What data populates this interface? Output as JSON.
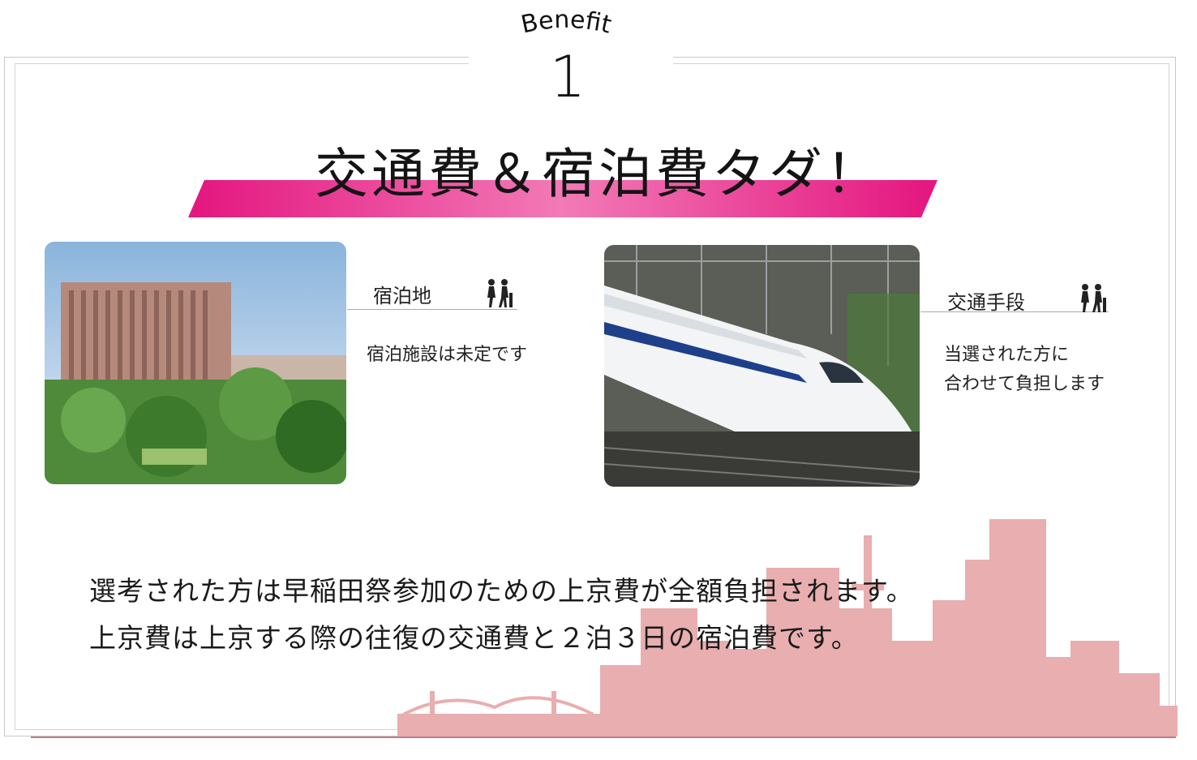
{
  "benefit": {
    "word": "Benefit",
    "number": "1"
  },
  "title": "交通費＆宿泊費タダ！",
  "lodging": {
    "label": "宿泊地",
    "description": "宿泊施設は未定です"
  },
  "transport": {
    "label": "交通手段",
    "description_lines": [
      "当選された方に",
      "合わせて負担します"
    ]
  },
  "body": {
    "lines": [
      "選考された方は早稲田祭参加のための上京費が全額負担されます。",
      "上京費は上京する際の往復の交通費と２泊３日の宿泊費です。"
    ]
  },
  "icons": {
    "lodging_walker": "walking-people-icon",
    "transport_walker": "walking-people-icon"
  },
  "colors": {
    "accent_pink": "#e4157f",
    "shadow": "#bd7c86",
    "skyline": "#e8aeb0"
  }
}
